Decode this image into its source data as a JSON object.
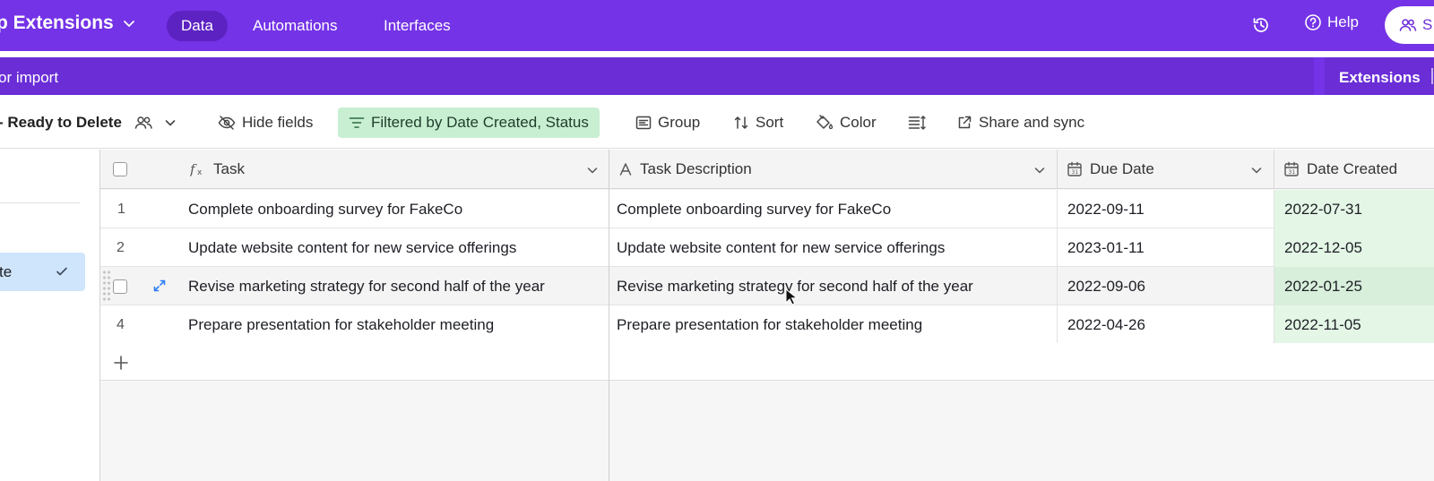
{
  "header": {
    "base_name": "p Extensions",
    "tabs": [
      {
        "label": "Data",
        "active": true
      },
      {
        "label": "Automations",
        "active": false
      },
      {
        "label": "Interfaces",
        "active": false
      }
    ],
    "help_label": "Help",
    "share_label": "S",
    "colors": {
      "header_bg": "#7433e6",
      "subbar_bg": "#6a2dd6",
      "active_tab_bg": "#5c22c2"
    }
  },
  "subbar": {
    "import_label": "or import",
    "extensions_label": "Extensions"
  },
  "toolbar": {
    "view_name": "- Ready to Delete",
    "hide_fields": "Hide fields",
    "filter_label": "Filtered by Date Created, Status",
    "group": "Group",
    "sort": "Sort",
    "color": "Color",
    "share_sync": "Share and sync",
    "filter_color": "#c9efd3"
  },
  "sidebar": {
    "selected_view_label": "te"
  },
  "table": {
    "columns": [
      {
        "name": "Task",
        "icon": "formula-icon"
      },
      {
        "name": "Task Description",
        "icon": "text-icon"
      },
      {
        "name": "Due Date",
        "icon": "calendar-icon"
      },
      {
        "name": "Date Created",
        "icon": "calendar-icon"
      }
    ],
    "rows": [
      {
        "num": "1",
        "task": "Complete onboarding survey for FakeCo",
        "description": "Complete onboarding survey for FakeCo",
        "due": "2022-09-11",
        "created": "2022-07-31"
      },
      {
        "num": "2",
        "task": "Update website content for new service offerings",
        "description": "Update website content for new service offerings",
        "due": "2023-01-11",
        "created": "2022-12-05"
      },
      {
        "num": "3",
        "task": "Revise marketing strategy for second half of the year",
        "description": "Revise marketing strategy for second half of the year",
        "due": "2022-09-06",
        "created": "2022-01-25"
      },
      {
        "num": "4",
        "task": "Prepare presentation for stakeholder meeting",
        "description": "Prepare presentation for stakeholder meeting",
        "due": "2022-04-26",
        "created": "2022-11-05"
      }
    ],
    "highlight_color": "#e4f6e6"
  }
}
